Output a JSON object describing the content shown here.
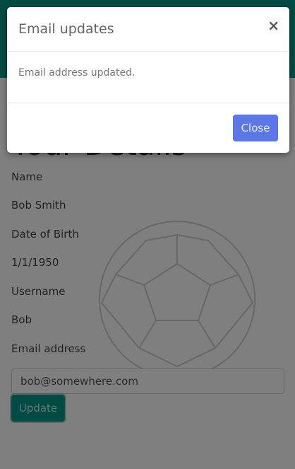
{
  "page": {
    "heading": "Your Details",
    "fields": {
      "name_label": "Name",
      "name_value": "Bob Smith",
      "dob_label": "Date of Birth",
      "dob_value": "1/1/1950",
      "username_label": "Username",
      "username_value": "Bob",
      "email_label": "Email address"
    },
    "email_input_value": "bob@somewhere.com",
    "update_label": "Update"
  },
  "modal": {
    "title": "Email updates",
    "close_glyph": "×",
    "message": "Email address updated.",
    "close_label": "Close"
  },
  "colors": {
    "primary_teal": "#009688",
    "modal_button_blue": "#5b78e6"
  },
  "icons": {
    "watermark": "soccer-ball-icon",
    "modal_close": "close-icon"
  }
}
